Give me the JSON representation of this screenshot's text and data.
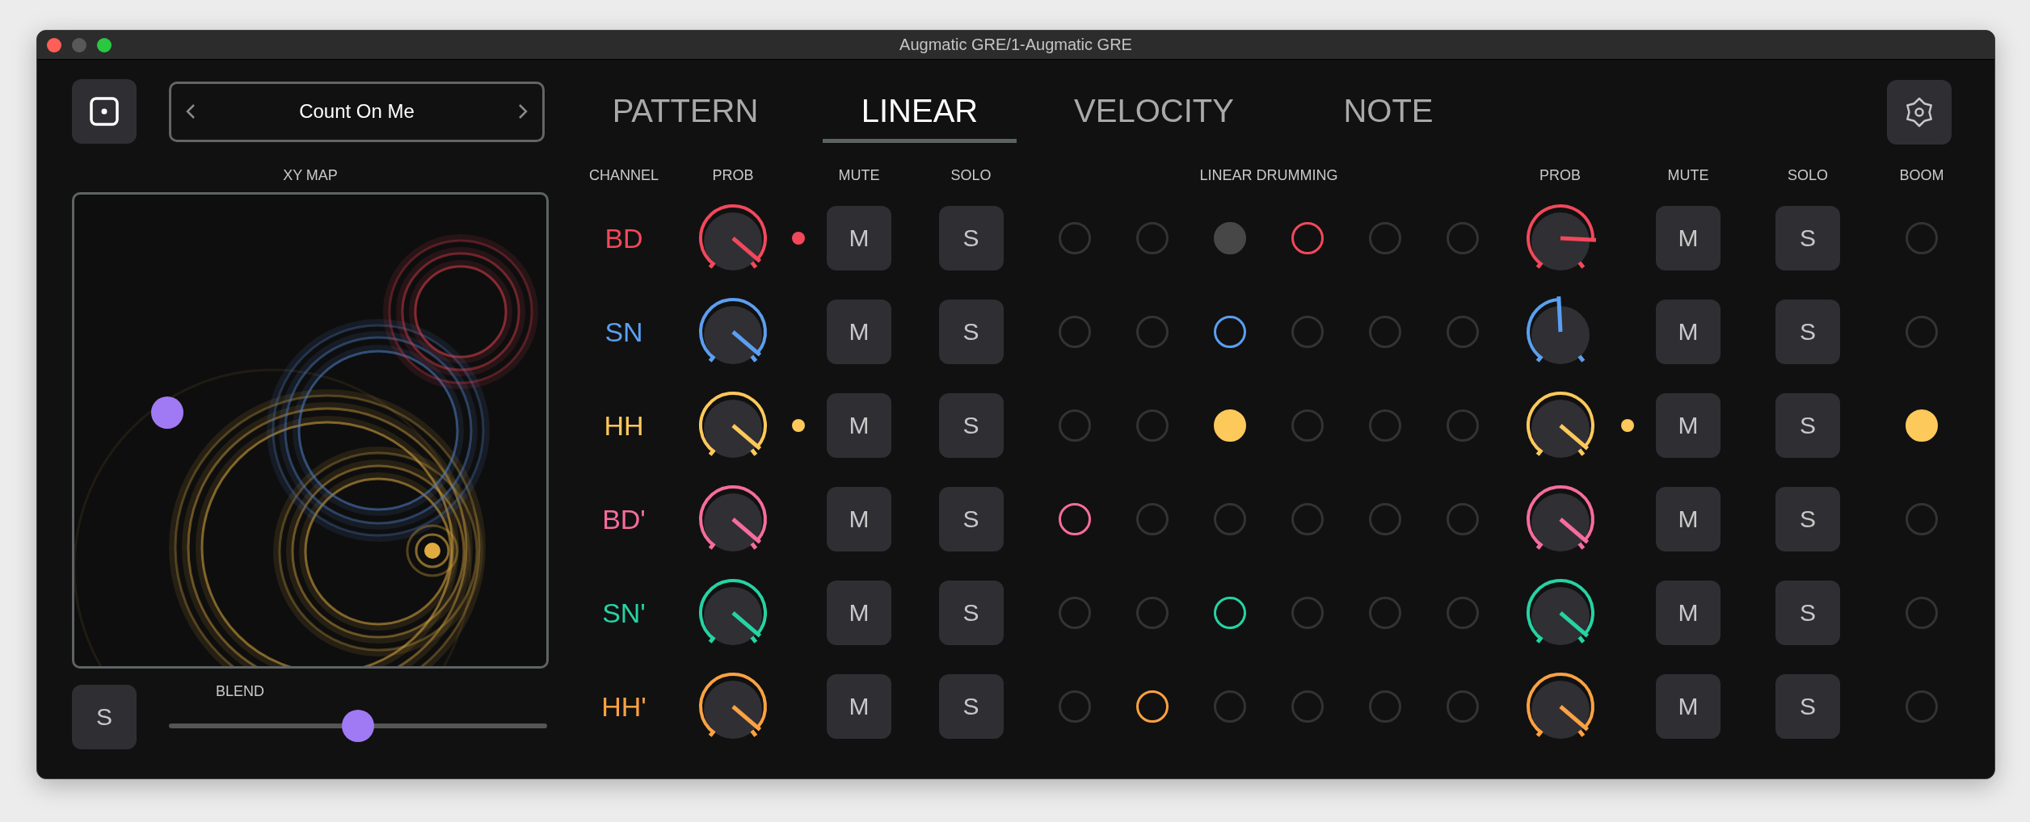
{
  "window": {
    "title": "Augmatic GRE/1-Augmatic GRE"
  },
  "preset": {
    "name": "Count On Me"
  },
  "tabs": [
    {
      "label": "PATTERN",
      "selected": false
    },
    {
      "label": "LINEAR",
      "selected": true
    },
    {
      "label": "VELOCITY",
      "selected": false
    },
    {
      "label": "NOTE",
      "selected": false
    }
  ],
  "xy_map": {
    "label": "XY MAP"
  },
  "solo_button": "S",
  "blend": {
    "label": "BLEND",
    "level": 0.5
  },
  "headers": [
    "CHANNEL",
    "PROB",
    "MUTE",
    "SOLO",
    "LINEAR DRUMMING",
    "PROB",
    "MUTE",
    "SOLO",
    "BOOM"
  ],
  "channels": [
    {
      "name": "BD",
      "color": "#f2485b",
      "prob": {
        "level": 0.95,
        "active": true
      },
      "mute": "M",
      "solo": "S",
      "steps": [
        {
          "kind": "empty"
        },
        {
          "kind": "empty"
        },
        {
          "kind": "dim"
        },
        {
          "kind": "ring"
        },
        {
          "kind": "empty"
        },
        {
          "kind": "empty"
        }
      ],
      "prob_right": {
        "level": 0.82,
        "active": false
      },
      "mute_right": "M",
      "solo_right": "S",
      "boom": {
        "on": false
      }
    },
    {
      "name": "SN",
      "color": "#5b9ff0",
      "prob": {
        "level": 0.95,
        "active": false
      },
      "mute": "M",
      "solo": "S",
      "steps": [
        {
          "kind": "empty"
        },
        {
          "kind": "empty"
        },
        {
          "kind": "ring"
        },
        {
          "kind": "empty"
        },
        {
          "kind": "empty"
        },
        {
          "kind": "empty"
        }
      ],
      "prob_right": {
        "level": 0.49,
        "active": false
      },
      "mute_right": "M",
      "solo_right": "S",
      "boom": {
        "on": false
      }
    },
    {
      "name": "HH",
      "color": "#fdc95b",
      "prob": {
        "level": 0.95,
        "active": true
      },
      "mute": "M",
      "solo": "S",
      "steps": [
        {
          "kind": "empty"
        },
        {
          "kind": "empty"
        },
        {
          "kind": "filled"
        },
        {
          "kind": "empty"
        },
        {
          "kind": "empty"
        },
        {
          "kind": "empty"
        }
      ],
      "prob_right": {
        "level": 0.95,
        "active": true
      },
      "mute_right": "M",
      "solo_right": "S",
      "boom": {
        "on": true
      }
    },
    {
      "name": "BD'",
      "color": "#f76c9d",
      "prob": {
        "level": 0.95,
        "active": false
      },
      "mute": "M",
      "solo": "S",
      "steps": [
        {
          "kind": "ring"
        },
        {
          "kind": "empty"
        },
        {
          "kind": "empty"
        },
        {
          "kind": "empty"
        },
        {
          "kind": "empty"
        },
        {
          "kind": "empty"
        }
      ],
      "prob_right": {
        "level": 0.95,
        "active": false
      },
      "mute_right": "M",
      "solo_right": "S",
      "boom": {
        "on": false
      }
    },
    {
      "name": "SN'",
      "color": "#26d3a3",
      "prob": {
        "level": 0.95,
        "active": false
      },
      "mute": "M",
      "solo": "S",
      "steps": [
        {
          "kind": "empty"
        },
        {
          "kind": "empty"
        },
        {
          "kind": "ring"
        },
        {
          "kind": "empty"
        },
        {
          "kind": "empty"
        },
        {
          "kind": "empty"
        }
      ],
      "prob_right": {
        "level": 0.95,
        "active": false
      },
      "mute_right": "M",
      "solo_right": "S",
      "boom": {
        "on": false
      }
    },
    {
      "name": "HH'",
      "color": "#fca242",
      "prob": {
        "level": 0.95,
        "active": false
      },
      "mute": "M",
      "solo": "S",
      "steps": [
        {
          "kind": "empty"
        },
        {
          "kind": "ring"
        },
        {
          "kind": "empty"
        },
        {
          "kind": "empty"
        },
        {
          "kind": "empty"
        },
        {
          "kind": "empty"
        }
      ],
      "prob_right": {
        "level": 0.95,
        "active": false
      },
      "mute_right": "M",
      "solo_right": "S",
      "boom": {
        "on": false
      }
    }
  ]
}
